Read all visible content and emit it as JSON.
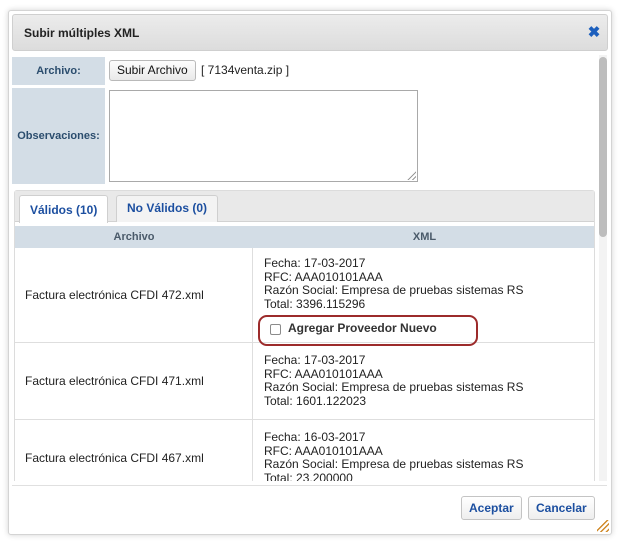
{
  "dialog": {
    "title": "Subir múltiples XML",
    "close_icon": "close-icon"
  },
  "form": {
    "archivo_label": "Archivo:",
    "upload_button": "Subir Archivo",
    "file_name": "[ 7134venta.zip ]",
    "observaciones_label": "Observaciones:",
    "observaciones_value": ""
  },
  "tabs": [
    {
      "label": "Válidos (10)",
      "active": true
    },
    {
      "label": "No Válidos (0)",
      "active": false
    }
  ],
  "grid": {
    "headers": [
      "Archivo",
      "XML"
    ],
    "rows": [
      {
        "archivo": "Factura electrónica CFDI 472.xml",
        "fecha": "Fecha: 17-03-2017",
        "rfc": "RFC: AAA010101AAA",
        "razon": "Razón Social: Empresa de pruebas sistemas RS",
        "total": "Total: 3396.115296",
        "agregar_proveedor": "Agregar Proveedor Nuevo"
      },
      {
        "archivo": "Factura electrónica CFDI 471.xml",
        "fecha": "Fecha: 17-03-2017",
        "rfc": "RFC: AAA010101AAA",
        "razon": "Razón Social: Empresa de pruebas sistemas RS",
        "total": "Total: 1601.122023"
      },
      {
        "archivo": "Factura electrónica CFDI 467.xml",
        "fecha": "Fecha: 16-03-2017",
        "rfc": "RFC: AAA010101AAA",
        "razon": "Razón Social: Empresa de pruebas sistemas RS",
        "total": "Total: 23.200000"
      }
    ]
  },
  "footer": {
    "accept": "Aceptar",
    "cancel": "Cancelar"
  },
  "colors": {
    "accent_blue": "#1c4fa0",
    "label_bg": "#d3dde6",
    "highlight_border": "#9c2b2b"
  }
}
